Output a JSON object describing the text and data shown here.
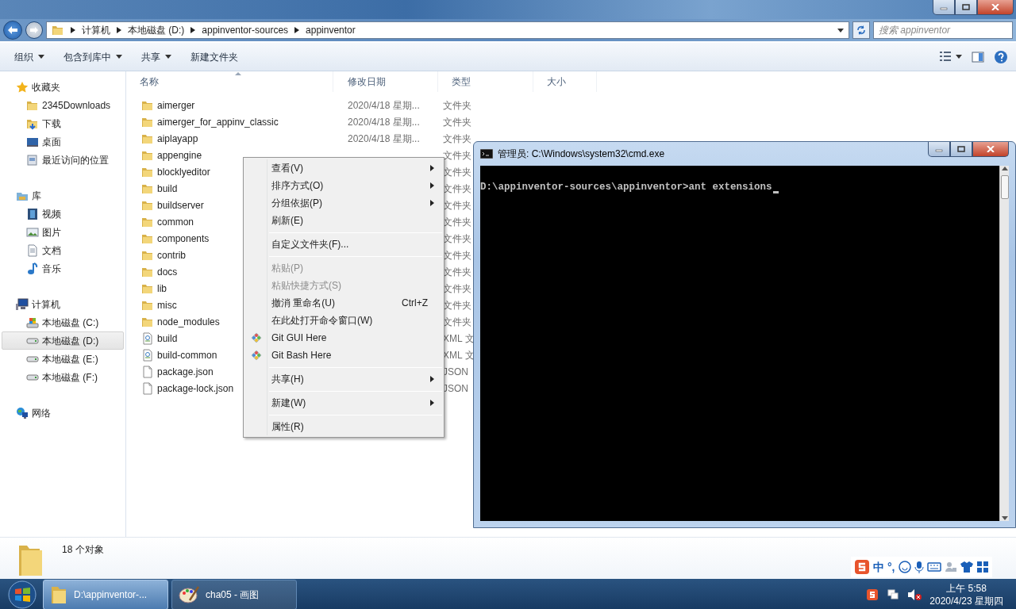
{
  "address_bar": {
    "crumbs": [
      "计算机",
      "本地磁盘 (D:)",
      "appinventor-sources",
      "appinventor"
    ]
  },
  "search": {
    "placeholder": "搜索 appinventor"
  },
  "toolbar": [
    {
      "label": "组织",
      "dropdown": true
    },
    {
      "label": "包含到库中",
      "dropdown": true
    },
    {
      "label": "共享",
      "dropdown": true
    },
    {
      "label": "新建文件夹",
      "dropdown": false
    }
  ],
  "sidebar": {
    "groups": [
      {
        "label": "收藏夹",
        "kind": "star",
        "children": [
          {
            "label": "2345Downloads",
            "kind": "folder",
            "selected": false
          },
          {
            "label": "下载",
            "kind": "download",
            "selected": false
          },
          {
            "label": "桌面",
            "kind": "desktop",
            "selected": false
          },
          {
            "label": "最近访问的位置",
            "kind": "recent",
            "selected": false
          }
        ]
      },
      {
        "label": "库",
        "kind": "library",
        "children": [
          {
            "label": "视频",
            "kind": "video",
            "selected": false
          },
          {
            "label": "图片",
            "kind": "picture",
            "selected": false
          },
          {
            "label": "文档",
            "kind": "document",
            "selected": false
          },
          {
            "label": "音乐",
            "kind": "music",
            "selected": false
          }
        ]
      },
      {
        "label": "计算机",
        "kind": "computer",
        "children": [
          {
            "label": "本地磁盘 (C:)",
            "kind": "systemdrive",
            "selected": false
          },
          {
            "label": "本地磁盘 (D:)",
            "kind": "drive",
            "selected": true
          },
          {
            "label": "本地磁盘 (E:)",
            "kind": "drive",
            "selected": false
          },
          {
            "label": "本地磁盘 (F:)",
            "kind": "drive",
            "selected": false
          }
        ]
      },
      {
        "label": "网络",
        "kind": "network"
      }
    ]
  },
  "file_list": {
    "columns": [
      "名称",
      "修改日期",
      "类型",
      "大小"
    ],
    "rows": [
      {
        "name": "aimerger",
        "kind": "folder",
        "modified": "2020/4/18 星期...",
        "type": "文件夹"
      },
      {
        "name": "aimerger_for_appinv_classic",
        "kind": "folder",
        "modified": "2020/4/18 星期...",
        "type": "文件夹"
      },
      {
        "name": "aiplayapp",
        "kind": "folder",
        "modified": "2020/4/18 星期...",
        "type": "文件夹"
      },
      {
        "name": "appengine",
        "kind": "folder",
        "type": "文件夹"
      },
      {
        "name": "blocklyeditor",
        "kind": "folder",
        "type": "文件夹"
      },
      {
        "name": "build",
        "kind": "folder",
        "type": "文件夹"
      },
      {
        "name": "buildserver",
        "kind": "folder",
        "type": "文件夹"
      },
      {
        "name": "common",
        "kind": "folder",
        "type": "文件夹"
      },
      {
        "name": "components",
        "kind": "folder",
        "type": "文件夹"
      },
      {
        "name": "contrib",
        "kind": "folder",
        "type": "文件夹"
      },
      {
        "name": "docs",
        "kind": "folder",
        "type": "文件夹"
      },
      {
        "name": "lib",
        "kind": "folder",
        "type": "文件夹"
      },
      {
        "name": "misc",
        "kind": "folder",
        "type": "文件夹"
      },
      {
        "name": "node_modules",
        "kind": "folder",
        "type": "文件夹"
      },
      {
        "name": "build",
        "kind": "xml",
        "type": "XML 文"
      },
      {
        "name": "build-common",
        "kind": "xml",
        "type": "XML 文"
      },
      {
        "name": "package.json",
        "kind": "file",
        "type": "JSON"
      },
      {
        "name": "package-lock.json",
        "kind": "file",
        "type": "JSON"
      }
    ]
  },
  "status_bar": {
    "count": "18 个对象"
  },
  "context_menu": [
    {
      "kind": "item",
      "label": "查看(V)",
      "submenu": true,
      "disabled": false
    },
    {
      "kind": "item",
      "label": "排序方式(O)",
      "submenu": true,
      "disabled": false
    },
    {
      "kind": "item",
      "label": "分组依据(P)",
      "submenu": true,
      "disabled": false
    },
    {
      "kind": "item",
      "label": "刷新(E)",
      "submenu": false,
      "disabled": false
    },
    {
      "kind": "separator"
    },
    {
      "kind": "item",
      "label": "自定义文件夹(F)...",
      "submenu": false,
      "disabled": false
    },
    {
      "kind": "separator"
    },
    {
      "kind": "item",
      "label": "粘贴(P)",
      "submenu": false,
      "disabled": true
    },
    {
      "kind": "item",
      "label": "粘贴快捷方式(S)",
      "submenu": false,
      "disabled": true
    },
    {
      "kind": "item",
      "label": "撤消 重命名(U)",
      "shortcut": "Ctrl+Z",
      "submenu": false,
      "disabled": false
    },
    {
      "kind": "item",
      "label": "在此处打开命令窗口(W)",
      "submenu": false,
      "disabled": false
    },
    {
      "kind": "git",
      "label": "Git GUI Here",
      "submenu": false,
      "disabled": false
    },
    {
      "kind": "git",
      "label": "Git Bash Here",
      "submenu": false,
      "disabled": false
    },
    {
      "kind": "separator"
    },
    {
      "kind": "item",
      "label": "共享(H)",
      "submenu": true,
      "disabled": false
    },
    {
      "kind": "separator"
    },
    {
      "kind": "item",
      "label": "新建(W)",
      "submenu": true,
      "disabled": false
    },
    {
      "kind": "separator"
    },
    {
      "kind": "item",
      "label": "属性(R)",
      "submenu": false,
      "disabled": false
    }
  ],
  "cmd_window": {
    "title": "管理员: C:\\Windows\\system32\\cmd.exe",
    "lines": [
      "D:\\appinventor-sources\\appinventor>ant extensions"
    ],
    "cursor": true
  },
  "ime_bar": {
    "texts": [
      "中",
      "°,"
    ]
  },
  "taskbar": {
    "tasks": [
      {
        "label": "D:\\appinventor-...",
        "kind": "folder",
        "selected": true
      },
      {
        "label": "cha05 - 画图",
        "kind": "paint",
        "selected": false
      }
    ],
    "clock": {
      "time": "上午 5:58",
      "date": "2020/4/23 星期四"
    }
  }
}
